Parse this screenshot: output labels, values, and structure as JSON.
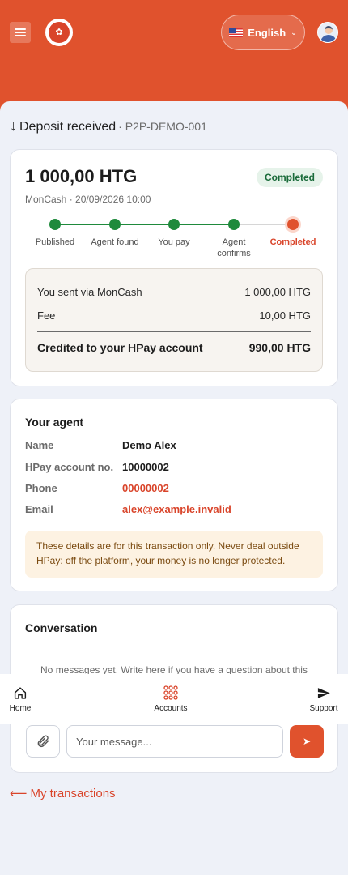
{
  "header": {
    "language": {
      "flag": "flag-us-icon",
      "label": "English"
    }
  },
  "page": {
    "title_arrow": "↓",
    "title": "Deposit received",
    "reference": "· P2P-DEMO-001"
  },
  "transaction": {
    "amount": "1 000,00 HTG",
    "status": "Completed",
    "method_date": "MonCash · 20/09/2026 10:00",
    "steps": [
      {
        "label": "Published",
        "state": "done"
      },
      {
        "label": "Agent found",
        "state": "done"
      },
      {
        "label": "You pay",
        "state": "done"
      },
      {
        "label": "Agent confirms",
        "state": "done"
      },
      {
        "label": "Completed",
        "state": "current"
      }
    ],
    "summary": {
      "sent_label": "You sent via MonCash",
      "sent_value": "1 000,00 HTG",
      "fee_label": "Fee",
      "fee_value": "10,00 HTG",
      "credited_label": "Credited to your HPay account",
      "credited_value": "990,00 HTG"
    }
  },
  "agent": {
    "heading": "Your agent",
    "name_label": "Name",
    "name": "Demo Alex",
    "account_label": "HPay account no.",
    "account": "10000002",
    "phone_label": "Phone",
    "phone": "00000002",
    "email_label": "Email",
    "email": "alex@example.invalid",
    "notice": "These details are for this transaction only. Never deal outside HPay: off the platform, your money is no longer protected."
  },
  "conversation": {
    "heading": "Conversation",
    "empty": "No messages yet. Write here if you have a question about this",
    "placeholder": "Your message..."
  },
  "back_link": "My transactions",
  "tabbar": {
    "home": "Home",
    "accounts": "Accounts",
    "support": "Support"
  },
  "colors": {
    "brand": "#e0522d",
    "success": "#1f8a3c",
    "background": "#eef1f8"
  }
}
